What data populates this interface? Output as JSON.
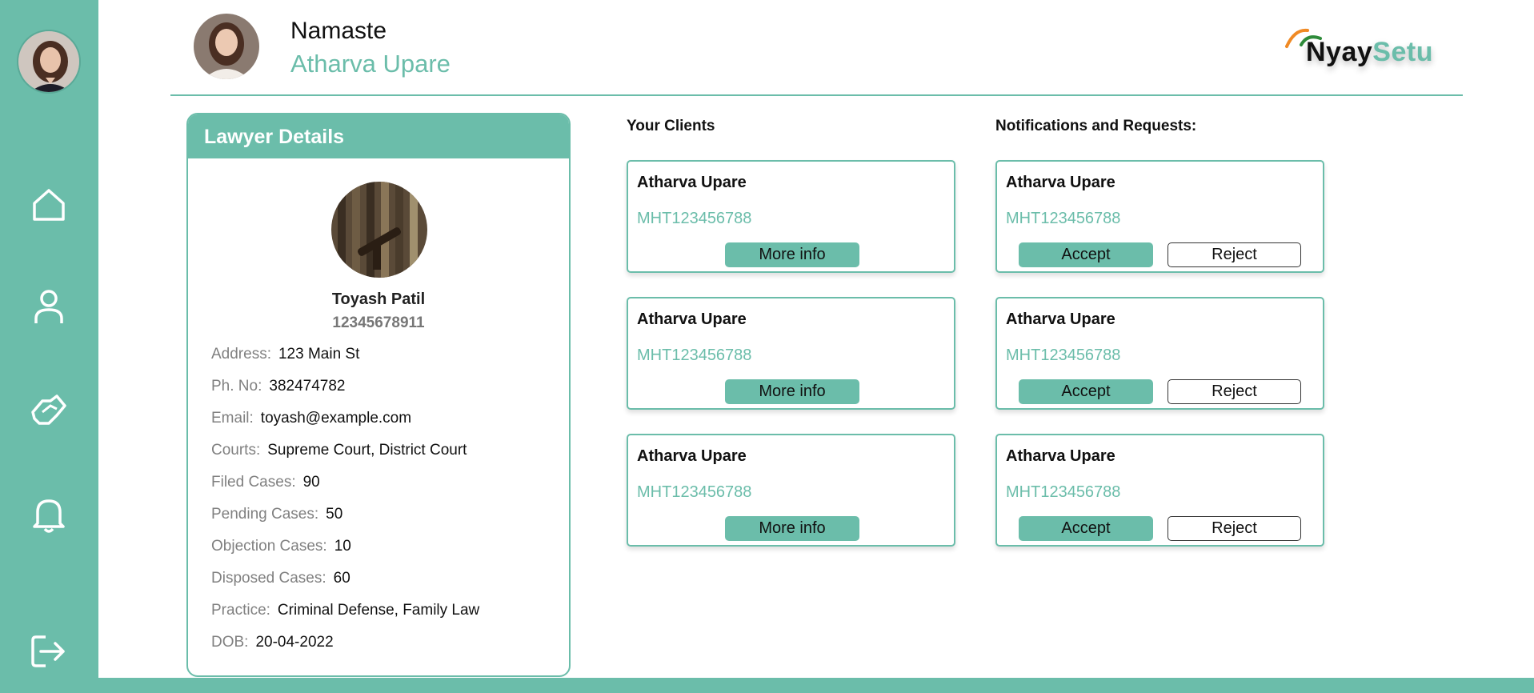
{
  "header": {
    "greeting": "Namaste",
    "user_name": "Atharva Upare",
    "logo": {
      "part1": "Nyay",
      "part2": "Setu"
    }
  },
  "sidebar": {
    "items": [
      {
        "name": "home",
        "icon": "home-icon"
      },
      {
        "name": "profile",
        "icon": "user-icon"
      },
      {
        "name": "cases",
        "icon": "handshake-icon"
      },
      {
        "name": "notifications",
        "icon": "bell-icon"
      },
      {
        "name": "logout",
        "icon": "logout-icon"
      }
    ]
  },
  "lawyer": {
    "title": "Lawyer Details",
    "name": "Toyash Patil",
    "id": "12345678911",
    "details": [
      {
        "label": "Address:",
        "value": "123 Main St"
      },
      {
        "label": "Ph. No:",
        "value": "382474782"
      },
      {
        "label": "Email:",
        "value": "toyash@example.com"
      },
      {
        "label": "Courts:",
        "value": "Supreme Court, District Court"
      },
      {
        "label": "Filed Cases:",
        "value": "90"
      },
      {
        "label": "Pending Cases:",
        "value": "50"
      },
      {
        "label": "Objection Cases:",
        "value": "10"
      },
      {
        "label": "Disposed Cases:",
        "value": "60"
      },
      {
        "label": "Practice:",
        "value": "Criminal Defense, Family Law"
      },
      {
        "label": "DOB:",
        "value": "20-04-2022"
      }
    ]
  },
  "clients": {
    "title": "Your Clients",
    "items": [
      {
        "name": "Atharva Upare",
        "id": "MHT123456788",
        "button": "More info"
      },
      {
        "name": "Atharva Upare",
        "id": "MHT123456788",
        "button": "More info"
      },
      {
        "name": "Atharva Upare",
        "id": "MHT123456788",
        "button": "More info"
      }
    ]
  },
  "notifications": {
    "title": "Notifications and Requests:",
    "items": [
      {
        "name": "Atharva Upare",
        "id": "MHT123456788",
        "accept": "Accept",
        "reject": "Reject"
      },
      {
        "name": "Atharva Upare",
        "id": "MHT123456788",
        "accept": "Accept",
        "reject": "Reject"
      },
      {
        "name": "Atharva Upare",
        "id": "MHT123456788",
        "accept": "Accept",
        "reject": "Reject"
      }
    ]
  },
  "colors": {
    "accent": "#6bbdaa",
    "logo_orange": "#f08a24",
    "logo_green": "#2e8b3a"
  }
}
